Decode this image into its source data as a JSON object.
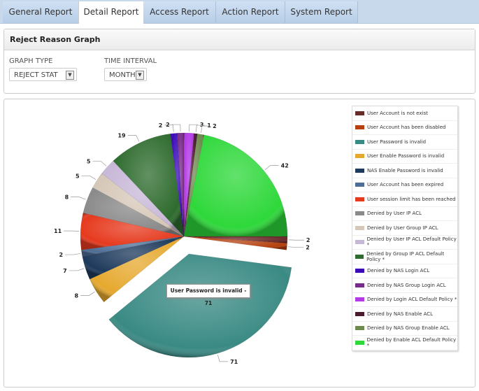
{
  "tabs": [
    {
      "label": "General Report"
    },
    {
      "label": "Detail Report",
      "active": true
    },
    {
      "label": "Access Report"
    },
    {
      "label": "Action Report"
    },
    {
      "label": "System Report"
    }
  ],
  "panel": {
    "title": "Reject Reason Graph",
    "graph_type_label": "GRAPH TYPE",
    "graph_type_value": "REJECT STAT",
    "time_interval_label": "TIME INTERVAL",
    "time_interval_value": "MONTH"
  },
  "tooltip": "User Password is invalid - 71",
  "chart_data": {
    "type": "pie",
    "exploded": "User Password is invalid",
    "legend_position": "right",
    "slices": [
      {
        "name": "User Account is not exist",
        "value": 2,
        "color": "#6b2a2a"
      },
      {
        "name": "User Account has been disabled",
        "value": 2,
        "color": "#b5400e"
      },
      {
        "name": "User Password is invalid",
        "value": 71,
        "color": "#3a8a84"
      },
      {
        "name": "User Enable Password is invalid",
        "value": 8,
        "color": "#e6a92f"
      },
      {
        "name": "NAS Enable Password is invalid",
        "value": 7,
        "color": "#1e3a5c"
      },
      {
        "name": "User Account has been expired",
        "value": 2,
        "color": "#4e6e96"
      },
      {
        "name": "User session limit has been reached",
        "value": 11,
        "color": "#e63a1e"
      },
      {
        "name": "Denied by User IP ACL",
        "value": 8,
        "color": "#8a8a8a"
      },
      {
        "name": "Denied by User Group IP ACL",
        "value": 5,
        "color": "#d6c8b8"
      },
      {
        "name": "Denied by User IP ACL Default Policy *",
        "value": 5,
        "color": "#c8b8d8"
      },
      {
        "name": "Denied by Group IP ACL Default Policy *",
        "value": 19,
        "color": "#2e6b2e"
      },
      {
        "name": "Denied by NAS Login ACL",
        "value": 2,
        "color": "#3a0ab8"
      },
      {
        "name": "Denied by NAS Group Login ACL",
        "value": 2,
        "color": "#7a2a8a"
      },
      {
        "name": "Denied by Login ACL Default Policy *",
        "value": 3,
        "color": "#b43ae6"
      },
      {
        "name": "Denied by NAS Enable ACL",
        "value": 1,
        "color": "#4a1a2e"
      },
      {
        "name": "Denied by NAS Group Enable ACL",
        "value": 2,
        "color": "#6e8a4e"
      },
      {
        "name": "Denied by Enable ACL Default Policy *",
        "value": 42,
        "color": "#2ed83a"
      }
    ]
  }
}
